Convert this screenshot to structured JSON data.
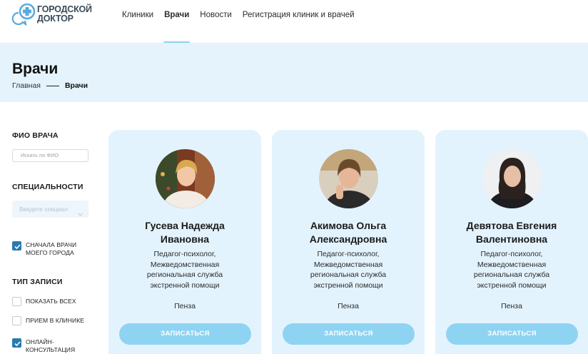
{
  "header": {
    "logo": {
      "line1": "ГОРОДСКОЙ",
      "line2": "ДОКТОР"
    },
    "nav": [
      {
        "label": "Клиники"
      },
      {
        "label": "Врачи",
        "active": true
      },
      {
        "label": "Новости"
      },
      {
        "label": "Регистрация клиник и врачей"
      }
    ]
  },
  "page": {
    "title": "Врачи",
    "breadcrumb": {
      "home": "Главная",
      "current": "Врачи"
    }
  },
  "filters": {
    "name_label": "ФИО ВРАЧА",
    "name_placeholder": "Искать по ФИО",
    "spec_label": "СПЕЦИАЛЬНОСТИ",
    "spec_placeholder": "Введите специал",
    "city_first": {
      "label": "Сначала врачи моего города",
      "checked": true
    },
    "type_label": "ТИП ЗАПИСИ",
    "types": [
      {
        "label": "Показать всех",
        "checked": false
      },
      {
        "label": "Прием в клинике",
        "checked": false
      },
      {
        "label": "Онлайн-консультация",
        "checked": true
      }
    ]
  },
  "doctors": [
    {
      "name_line1": "Гусева Надежда",
      "name_line2": "Ивановна",
      "role": [
        "Педагог-психолог,",
        "Межведомственная",
        "региональная служба",
        "экстренной помощи"
      ],
      "city": "Пенза",
      "button": "ЗАПИСАТЬСЯ"
    },
    {
      "name_line1": "Акимова Ольга",
      "name_line2": "Александровна",
      "role": [
        "Педагог-психолог,",
        "Межведомственная",
        "региональная служба",
        "экстренной помощи"
      ],
      "city": "Пенза",
      "button": "ЗАПИСАТЬСЯ"
    },
    {
      "name_line1": "Девятова Евгения",
      "name_line2": "Валентиновна",
      "role": [
        "Педагог-психолог,",
        "Межведомственная",
        "региональная служба",
        "экстренной помощи"
      ],
      "city": "Пенза",
      "button": "ЗАПИСАТЬСЯ"
    }
  ],
  "colors": {
    "accent": "#8fd3f3",
    "band": "#e4f3fc",
    "card": "#e3f3fd",
    "checkbox": "#2a7ab0"
  }
}
